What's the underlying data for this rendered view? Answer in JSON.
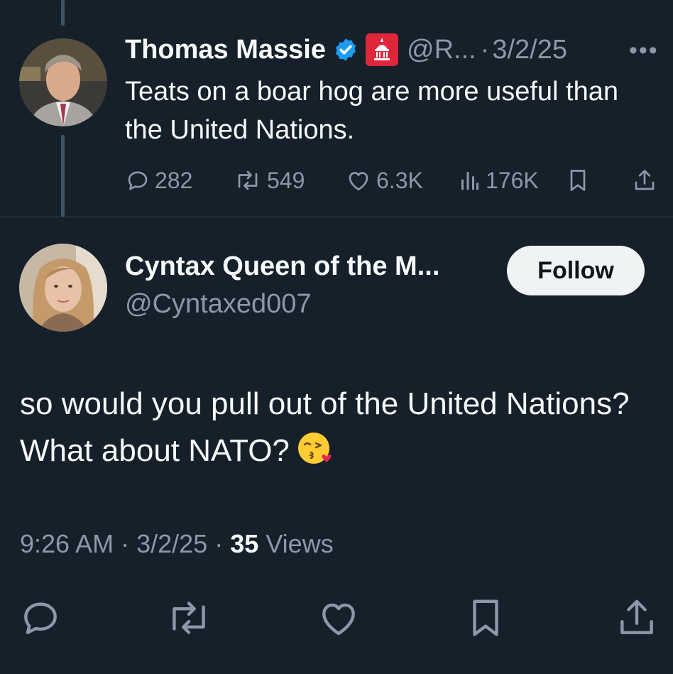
{
  "parent_tweet": {
    "author_name": "Thomas Massie",
    "handle": "@R...",
    "date_separator": "·",
    "date": "3/2/25",
    "more_label": "•••",
    "text": "Teats on a boar hog are more useful than the United Nations.",
    "actions": {
      "replies": "282",
      "retweets": "549",
      "likes": "6.3K",
      "views": "176K"
    }
  },
  "reply_tweet": {
    "author_name": "Cyntax Queen of the M...",
    "handle": "@Cyntaxed007",
    "follow_label": "Follow",
    "text": "so would you pull out of the United Nations? What about NATO?",
    "time": "9:26 AM",
    "separator": "·",
    "date": "3/2/25",
    "views_count": "35",
    "views_label": "Views"
  },
  "icons": {
    "verified": "verified-badge-icon",
    "affiliation": "gop-capitol-badge-icon",
    "reply": "reply-icon",
    "retweet": "retweet-icon",
    "like": "heart-icon",
    "views": "views-icon",
    "bookmark": "bookmark-icon",
    "share": "share-icon",
    "emoji": "kissing-face-emoji-icon"
  },
  "colors": {
    "background": "#15202b",
    "text": "#f7f9f9",
    "muted": "#8b98a5",
    "verified": "#1d9bf0",
    "affiliation": "#e0263b",
    "follow_bg": "#eff3f4"
  }
}
